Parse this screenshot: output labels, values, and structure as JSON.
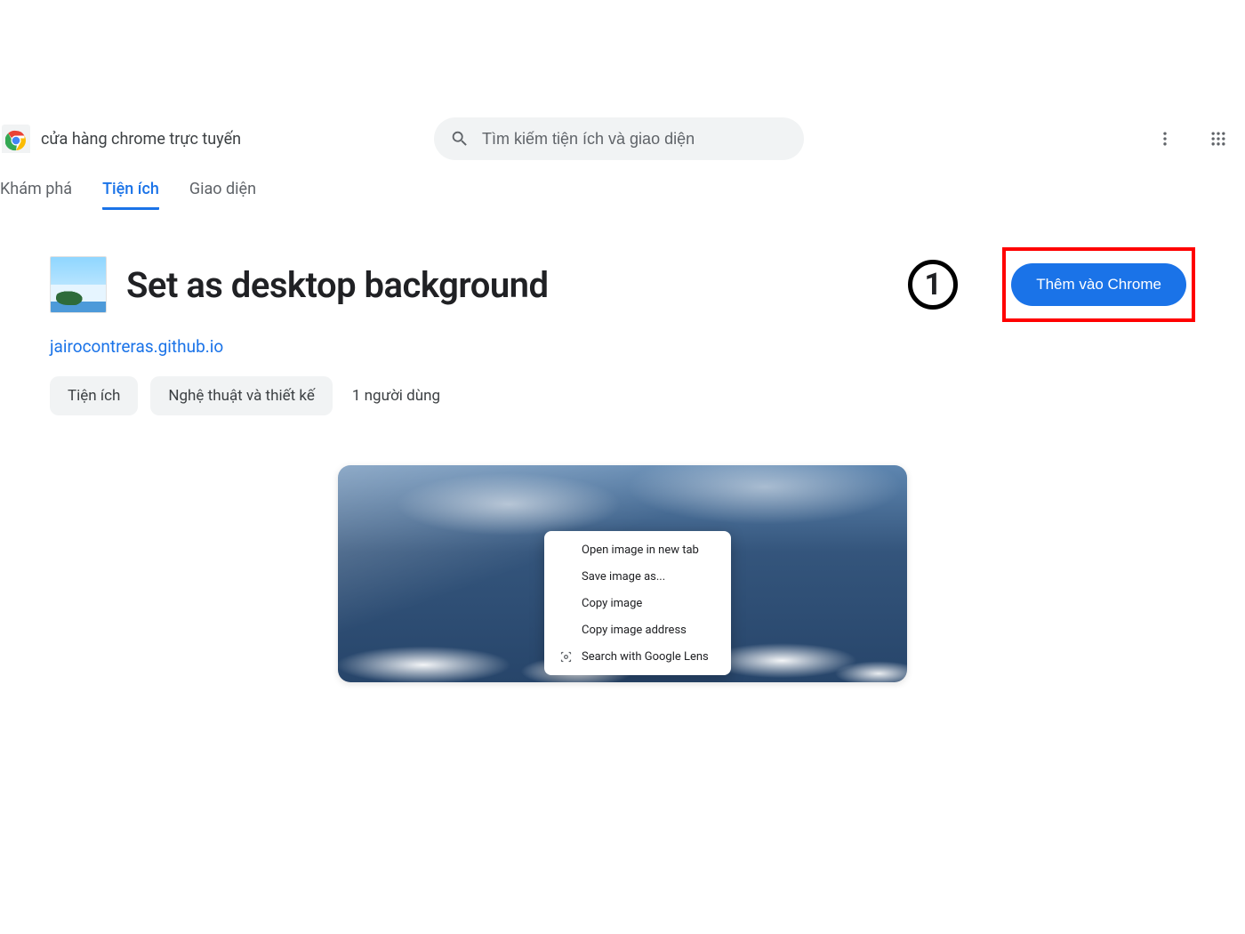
{
  "header": {
    "store_title": "cửa hàng chrome trực tuyến",
    "search_placeholder": "Tìm kiếm tiện ích và giao diện"
  },
  "tabs": {
    "discover": "Khám phá",
    "extensions": "Tiện ích",
    "themes": "Giao diện"
  },
  "extension": {
    "title": "Set as desktop background",
    "developer_link": "jairocontreras.github.io",
    "install_label": "Thêm vào Chrome",
    "chip_type": "Tiện ích",
    "chip_category": "Nghệ thuật và thiết kế",
    "users": "1 người dùng"
  },
  "annotation": {
    "number": "1"
  },
  "context_menu": {
    "items": [
      "Open image in new tab",
      "Save image as...",
      "Copy image",
      "Copy image address",
      "Search with Google Lens"
    ]
  }
}
